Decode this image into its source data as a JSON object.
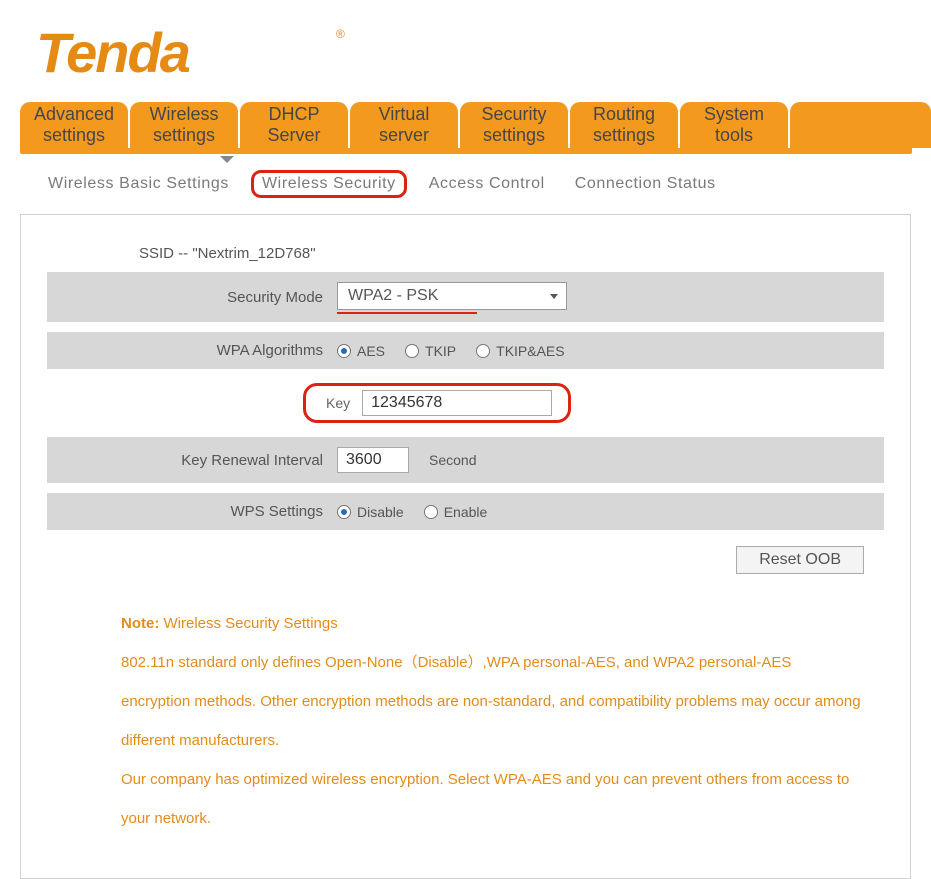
{
  "brand": "Tenda",
  "mainnav": [
    "Advanced\nsettings",
    "Wireless\nsettings",
    "DHCP\nServer",
    "Virtual\nserver",
    "Security\nsettings",
    "Routing\nsettings",
    "System\ntools"
  ],
  "mainnav_active_index": 1,
  "subnav": {
    "items": [
      "Wireless Basic Settings",
      "Wireless Security",
      "Access Control",
      "Connection Status"
    ],
    "active_index": 1
  },
  "form": {
    "ssid_label": "SSID -- \"Nextrim_12D768\"",
    "security_mode_label": "Security Mode",
    "security_mode_value": "WPA2 - PSK",
    "wpa_alg_label": "WPA Algorithms",
    "wpa_alg_options": [
      "AES",
      "TKIP",
      "TKIP&AES"
    ],
    "wpa_alg_selected": "AES",
    "key_label": "Key",
    "key_value": "12345678",
    "key_renewal_label": "Key Renewal Interval",
    "key_renewal_value": "3600",
    "key_renewal_unit": "Second",
    "wps_label": "WPS Settings",
    "wps_options": [
      "Disable",
      "Enable"
    ],
    "wps_selected": "Disable",
    "reset_btn": "Reset OOB"
  },
  "note": {
    "title": "Note:",
    "heading": "Wireless Security Settings",
    "body1": "802.11n standard only defines Open-None（Disable）,WPA personal-AES, and WPA2 personal-AES encryption methods. Other encryption methods are non-standard, and compatibility problems may occur among different manufacturers.",
    "body2": "Our company has optimized wireless encryption. Select WPA-AES and you can prevent others from access to your network."
  }
}
